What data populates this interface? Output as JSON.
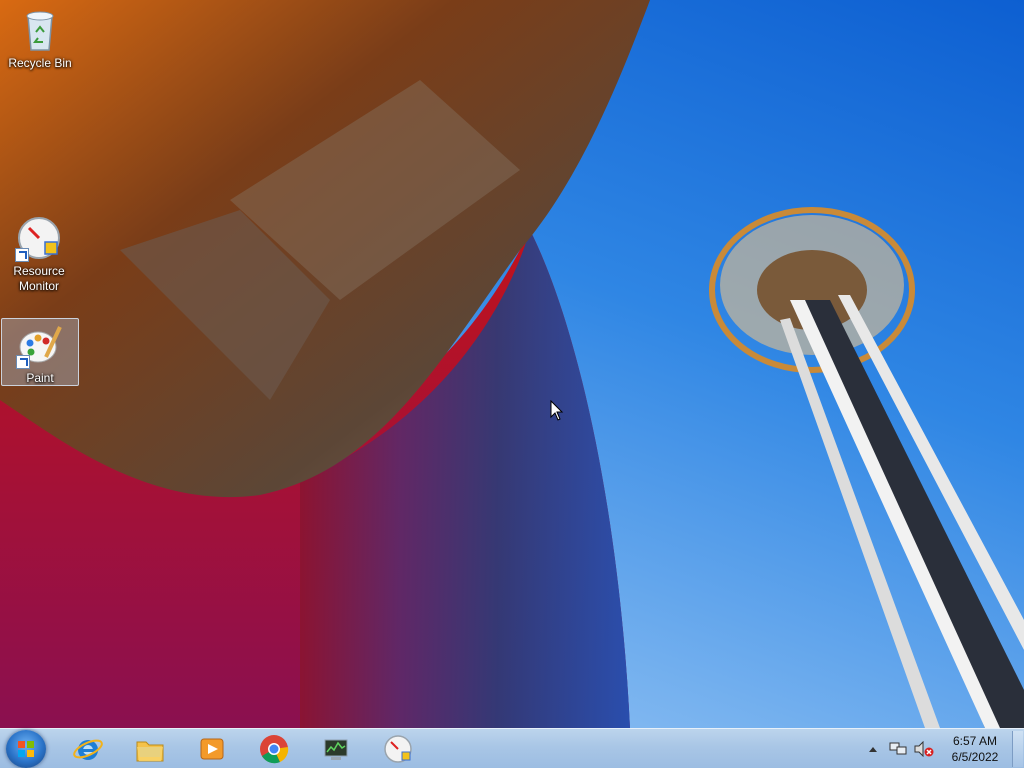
{
  "desktop": {
    "icons": [
      {
        "label": "Recycle Bin",
        "icon": "recycle-bin-icon"
      },
      {
        "label": "Resource Monitor",
        "icon": "resource-monitor-icon"
      },
      {
        "label": "Paint",
        "icon": "paint-icon"
      }
    ]
  },
  "taskbar": {
    "start": "start-orb-icon",
    "pinned": [
      {
        "name": "Internet Explorer",
        "icon": "internet-explorer-icon"
      },
      {
        "name": "Windows Explorer",
        "icon": "folder-icon"
      },
      {
        "name": "Windows Media Player",
        "icon": "media-player-icon"
      },
      {
        "name": "Google Chrome",
        "icon": "chrome-icon"
      },
      {
        "name": "Task Manager",
        "icon": "task-manager-icon"
      },
      {
        "name": "Resource Monitor",
        "icon": "resource-monitor-icon"
      }
    ],
    "tray": {
      "time": "6:57 AM",
      "date": "6/5/2022"
    }
  },
  "colors": {
    "taskbar": "#a9c6e6",
    "sky": "#2f86e4",
    "selection": "#b4d2f0"
  }
}
